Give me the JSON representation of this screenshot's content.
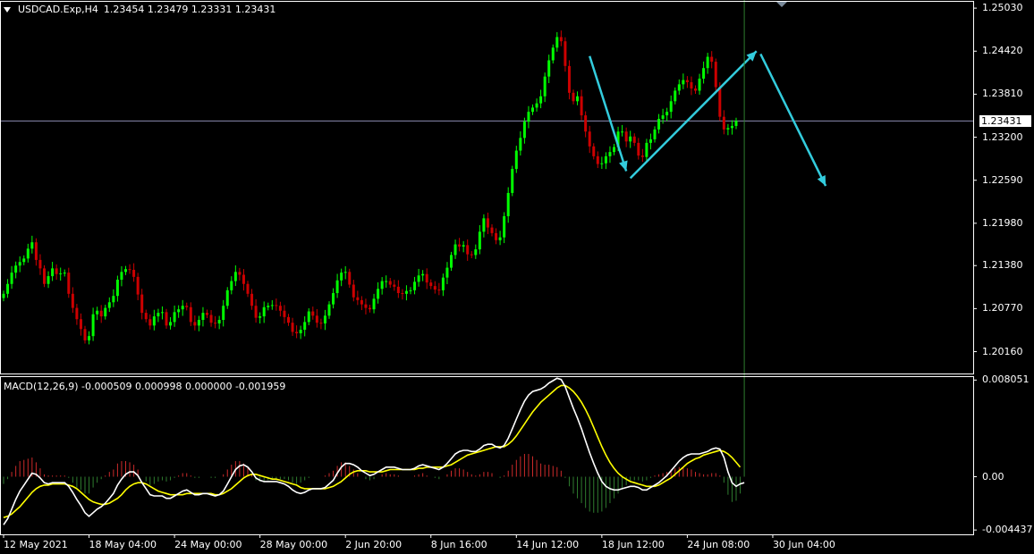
{
  "header": {
    "symbol": "USDCAD.Exp,H4",
    "ohlc": "1.23454 1.23479 1.23331 1.23431"
  },
  "current_price": {
    "value": 1.23431,
    "label": "1.23431"
  },
  "macd_header": {
    "text": "MACD(12,26,9) -0.000509 0.000998 0.000000 -0.001959"
  },
  "colors": {
    "background": "#000000",
    "grid_border": "#ffffff",
    "bull_candle": "#00ff00",
    "bear_candle": "#cc0000",
    "price_line": "#8a8ab0",
    "arrow": "#33ccdd",
    "macd_main": "#ffffff",
    "macd_signal": "#ffff00",
    "histogram_positive": "#cc2a2a",
    "histogram_negative": "#2f7d2f"
  },
  "chart_data": [
    {
      "type": "candlestick",
      "title": "USDCAD.Exp,H4",
      "ylim": [
        1.1985,
        1.2512
      ],
      "y_ticks": [
        "1.25030",
        "1.24420",
        "1.23810",
        "1.23200",
        "1.22590",
        "1.21980",
        "1.21380",
        "1.20770",
        "1.20160"
      ],
      "x_ticks": [
        "12 May 2021",
        "18 May 04:00",
        "24 May 00:00",
        "28 May 00:00",
        "2 Jun 20:00",
        "8 Jun 16:00",
        "14 Jun 12:00",
        "18 Jun 12:00",
        "24 Jun 08:00",
        "30 Jun 04:00"
      ],
      "close": [
        1.2098,
        1.2112,
        1.2128,
        1.2138,
        1.2143,
        1.2148,
        1.2162,
        1.2171,
        1.2146,
        1.2134,
        1.2112,
        1.2123,
        1.2134,
        1.2126,
        1.2127,
        1.2128,
        1.2098,
        1.2078,
        1.2062,
        1.2048,
        1.2032,
        1.2038,
        1.2069,
        1.2074,
        1.2066,
        1.2078,
        1.2086,
        1.2095,
        1.2118,
        1.2129,
        1.2133,
        1.2132,
        1.2122,
        1.2097,
        1.2071,
        1.2062,
        1.2053,
        1.2066,
        1.2071,
        1.2072,
        1.2053,
        1.2058,
        1.2072,
        1.2076,
        1.2081,
        1.2079,
        1.2058,
        1.2053,
        1.2061,
        1.2071,
        1.2068,
        1.2057,
        1.2056,
        1.2061,
        1.2081,
        1.2103,
        1.2116,
        1.2129,
        1.2125,
        1.2112,
        1.2098,
        1.2081,
        1.2064,
        1.2066,
        1.2079,
        1.2081,
        1.2082,
        1.2081,
        1.2074,
        1.2065,
        1.2057,
        1.2044,
        1.2042,
        1.2047,
        1.2058,
        1.2073,
        1.2067,
        1.2057,
        1.2056,
        1.2067,
        1.2083,
        1.2099,
        1.2117,
        1.2128,
        1.2129,
        1.2111,
        1.2093,
        1.2089,
        1.2083,
        1.2078,
        1.2076,
        1.2091,
        1.2105,
        1.2116,
        1.2116,
        1.2111,
        1.2108,
        1.2099,
        1.2098,
        1.2102,
        1.2103,
        1.2115,
        1.2124,
        1.2126,
        1.2114,
        1.2109,
        1.2104,
        1.2103,
        1.2121,
        1.2135,
        1.2153,
        1.2168,
        1.2165,
        1.2167,
        1.2154,
        1.2153,
        1.2161,
        1.2186,
        1.2205,
        1.2192,
        1.2184,
        1.2174,
        1.2178,
        1.2208,
        1.2241,
        1.2275,
        1.2301,
        1.2319,
        1.2342,
        1.2356,
        1.2362,
        1.2368,
        1.2378,
        1.2406,
        1.2429,
        1.2447,
        1.2462,
        1.2456,
        1.2421,
        1.2383,
        1.2371,
        1.2378,
        1.2351,
        1.2328,
        1.2307,
        1.2293,
        1.2282,
        1.2283,
        1.2293,
        1.2299,
        1.2306,
        1.2328,
        1.2328,
        1.2314,
        1.2321,
        1.2312,
        1.2294,
        1.2292,
        1.2312,
        1.2317,
        1.2331,
        1.2346,
        1.2351,
        1.2356,
        1.2371,
        1.2386,
        1.2395,
        1.2401,
        1.2398,
        1.2389,
        1.2386,
        1.2403,
        1.2418,
        1.2434,
        1.2427,
        1.2391,
        1.2349,
        1.2331,
        1.2333,
        1.2336,
        1.23431
      ]
    },
    {
      "type": "line",
      "title": "MACD(12,26,9) -0.000509 0.000998 0.000000 -0.001959",
      "ylim": [
        -0.0048,
        0.0083
      ],
      "y_ticks": [
        "0.008051",
        "0.00",
        "-0.004437"
      ],
      "series": [
        {
          "name": "macd_main",
          "values": [
            -0.004,
            -0.0035,
            -0.0027,
            -0.0019,
            -0.0012,
            -0.0007,
            -0.0002,
            0.0003,
            0.0002,
            -0.0001,
            -0.0005,
            -0.0006,
            -0.0005,
            -0.0005,
            -0.0005,
            -0.0005,
            -0.0008,
            -0.0013,
            -0.0019,
            -0.0024,
            -0.003,
            -0.0033,
            -0.003,
            -0.0027,
            -0.0025,
            -0.0022,
            -0.0018,
            -0.0014,
            -0.0007,
            -0.0002,
            0.0002,
            0.0004,
            0.0004,
            0.0001,
            -0.0005,
            -0.001,
            -0.0015,
            -0.0016,
            -0.0016,
            -0.0016,
            -0.0018,
            -0.0018,
            -0.0016,
            -0.0014,
            -0.0012,
            -0.0011,
            -0.0013,
            -0.0015,
            -0.0015,
            -0.0014,
            -0.0014,
            -0.0015,
            -0.0016,
            -0.0015,
            -0.0012,
            -0.0006,
            0.0,
            0.0006,
            0.0009,
            0.001,
            0.0008,
            0.0004,
            -0.0001,
            -0.0003,
            -0.0004,
            -0.0004,
            -0.0004,
            -0.0004,
            -0.0005,
            -0.0006,
            -0.0008,
            -0.0011,
            -0.0013,
            -0.0014,
            -0.0013,
            -0.0011,
            -0.001,
            -0.001,
            -0.001,
            -0.0009,
            -0.0006,
            -0.0003,
            0.0003,
            0.0008,
            0.0011,
            0.0011,
            0.001,
            0.0008,
            0.0005,
            0.0003,
            0.0001,
            0.0002,
            0.0004,
            0.0006,
            0.0008,
            0.0008,
            0.0008,
            0.0007,
            0.0006,
            0.0006,
            0.0006,
            0.0007,
            0.0009,
            0.001,
            0.0009,
            0.0008,
            0.0007,
            0.0006,
            0.0008,
            0.0011,
            0.0015,
            0.0019,
            0.0021,
            0.0022,
            0.0022,
            0.0021,
            0.0021,
            0.0023,
            0.0026,
            0.0027,
            0.0027,
            0.0025,
            0.0024,
            0.0026,
            0.0032,
            0.004,
            0.0048,
            0.0056,
            0.0063,
            0.0068,
            0.0071,
            0.0072,
            0.0073,
            0.0075,
            0.0078,
            0.008,
            0.0082,
            0.0081,
            0.0075,
            0.0066,
            0.0057,
            0.0049,
            0.004,
            0.003,
            0.002,
            0.0011,
            0.0003,
            -0.0004,
            -0.0008,
            -0.001,
            -0.0011,
            -0.0011,
            -0.001,
            -0.0009,
            -0.0008,
            -0.0008,
            -0.0009,
            -0.0011,
            -0.0011,
            -0.0009,
            -0.0007,
            -0.0005,
            -0.0002,
            0.0001,
            0.0005,
            0.0009,
            0.0013,
            0.0016,
            0.0018,
            0.0019,
            0.0019,
            0.0019,
            0.002,
            0.0021,
            0.0023,
            0.0024,
            0.0023,
            0.0016,
            0.0004,
            -0.0005,
            -0.0008,
            -0.0006,
            -0.0005
          ]
        },
        {
          "name": "macd_signal",
          "values": [
            -0.0034,
            -0.0033,
            -0.0031,
            -0.0028,
            -0.0025,
            -0.0021,
            -0.0017,
            -0.0013,
            -0.001,
            -0.0008,
            -0.0007,
            -0.0007,
            -0.0006,
            -0.0006,
            -0.0006,
            -0.0006,
            -0.0007,
            -0.0008,
            -0.001,
            -0.0013,
            -0.0016,
            -0.0019,
            -0.0021,
            -0.0022,
            -0.0023,
            -0.0023,
            -0.0022,
            -0.002,
            -0.0018,
            -0.0015,
            -0.0011,
            -0.0008,
            -0.0006,
            -0.0005,
            -0.0005,
            -0.0006,
            -0.0008,
            -0.001,
            -0.0012,
            -0.0013,
            -0.0014,
            -0.0015,
            -0.0015,
            -0.0015,
            -0.0015,
            -0.0014,
            -0.0014,
            -0.0014,
            -0.0014,
            -0.0014,
            -0.0014,
            -0.0014,
            -0.0015,
            -0.0015,
            -0.0014,
            -0.0012,
            -0.001,
            -0.0007,
            -0.0004,
            -0.0001,
            0.0001,
            0.0002,
            0.0002,
            0.0001,
            0.0,
            -0.0001,
            -0.0002,
            -0.0002,
            -0.0003,
            -0.0004,
            -0.0005,
            -0.0006,
            -0.0007,
            -0.0009,
            -0.001,
            -0.001,
            -0.001,
            -0.001,
            -0.001,
            -0.001,
            -0.0009,
            -0.0008,
            -0.0006,
            -0.0004,
            -0.0001,
            0.0002,
            0.0004,
            0.0005,
            0.0005,
            0.0005,
            0.0004,
            0.0004,
            0.0004,
            0.0004,
            0.0005,
            0.0006,
            0.0006,
            0.0006,
            0.0006,
            0.0006,
            0.0006,
            0.0006,
            0.0007,
            0.0007,
            0.0008,
            0.0008,
            0.0008,
            0.0008,
            0.0008,
            0.0009,
            0.001,
            0.0012,
            0.0014,
            0.0016,
            0.0018,
            0.0019,
            0.002,
            0.0021,
            0.0022,
            0.0023,
            0.0024,
            0.0025,
            0.0025,
            0.0025,
            0.0027,
            0.003,
            0.0034,
            0.0039,
            0.0044,
            0.0049,
            0.0054,
            0.0058,
            0.0062,
            0.0065,
            0.0068,
            0.0071,
            0.0074,
            0.0076,
            0.0076,
            0.0074,
            0.0071,
            0.0067,
            0.0062,
            0.0056,
            0.0049,
            0.0041,
            0.0033,
            0.0025,
            0.0018,
            0.0012,
            0.0007,
            0.0003,
            0.0,
            -0.0002,
            -0.0004,
            -0.0005,
            -0.0006,
            -0.0007,
            -0.0008,
            -0.0008,
            -0.0008,
            -0.0007,
            -0.0005,
            -0.0003,
            -0.0001,
            0.0002,
            0.0005,
            0.0008,
            0.0011,
            0.0013,
            0.0015,
            0.0016,
            0.0018,
            0.0019,
            0.002,
            0.0021,
            0.0022,
            0.0021,
            0.0019,
            0.0016,
            0.0012,
            0.0008
          ]
        }
      ]
    }
  ],
  "annotation_arrows": [
    {
      "from_bar": 144,
      "from_value": 1.2435,
      "to_bar": 153,
      "to_value": 1.2272
    },
    {
      "from_bar": 154,
      "from_value": 1.2262,
      "to_bar": 185,
      "to_value": 1.2442
    },
    {
      "from_bar": 186,
      "from_value": 1.2438,
      "to_bar": 202,
      "to_value": 1.2251
    }
  ]
}
